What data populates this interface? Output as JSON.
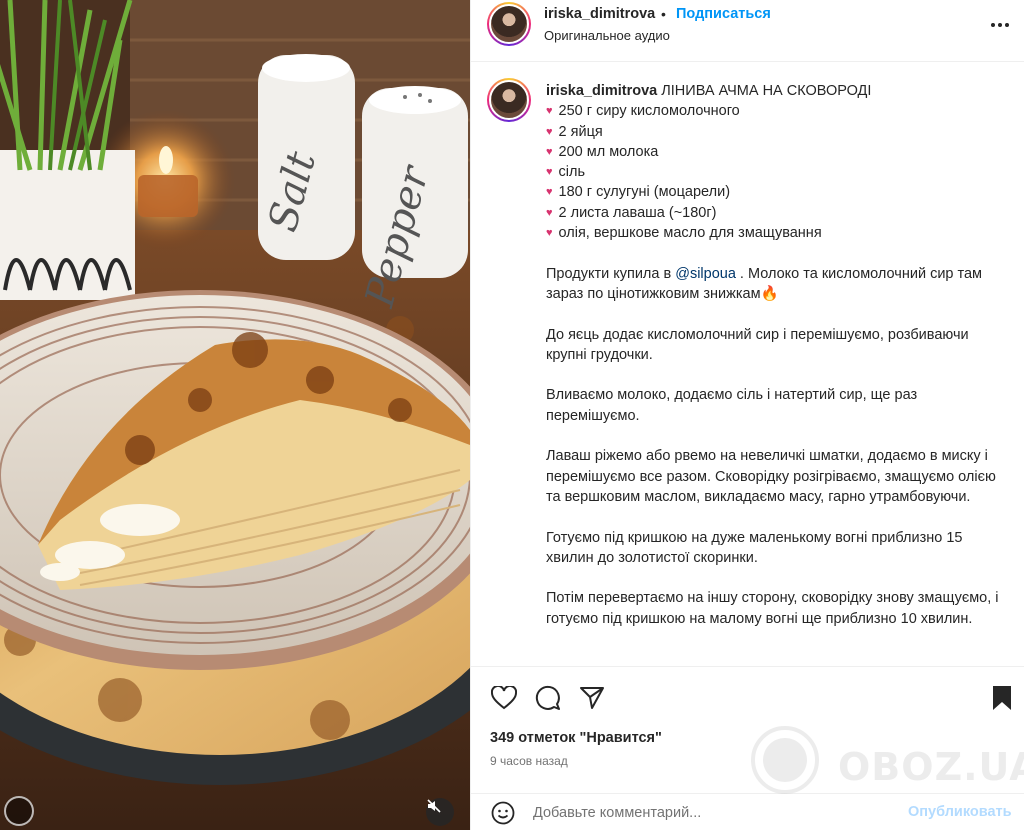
{
  "header": {
    "username": "iriska_dimitrova",
    "separator": "•",
    "follow_label": "Подписаться",
    "audio_label": "Оригинальное аудио",
    "more_icon": "more-horizontal-icon"
  },
  "caption": {
    "username": "iriska_dimitrova",
    "title": "ЛІНИВА АЧМА НА СКОВОРОДІ",
    "ingredients": [
      "250 г сиру кисломолочного",
      "2 яйця",
      "200 мл молока",
      "сіль",
      "180 г сулугуні (моцарели)",
      "2 листа лаваша (~180г)",
      "олія, вершкове масло для змащування"
    ],
    "shop_prefix": "Продукти купила в ",
    "shop_mention": "@silpoua",
    "shop_suffix": " . Молоко та кисломолочний сир там зараз по цінотижковим знижкам🔥",
    "paragraphs": [
      "До яєць додає кисломолочний сир і перемішуємо, розбиваючи крупні грудочки.",
      "Вливаємо молоко, додаємо сіль і натертий сир, ще раз перемішуємо.",
      "Лаваш ріжемо або рвемо на невеличкі шматки, додаємо в миску і перемішуємо все разом. Сковорідку розігріваємо, змащуємо олією та вершковим маслом, викладаємо масу, гарно утрамбовуючи.",
      "Готуємо під кришкою на дуже маленькому вогні приблизно 15 хвилин до золотистої скоринки.",
      "Потім перевертаємо на іншу сторону, сковорідку знову змащуємо, і готуємо під кришкою на малому вогні ще приблизно 10 хвилин."
    ]
  },
  "actions": {
    "likes": "349 отметок \"Нравится\"",
    "time_ago": "9 часов назад"
  },
  "comment": {
    "placeholder": "Добавьте комментарий...",
    "publish_label": "Опубликовать"
  },
  "media": {
    "salt_label": "Salt",
    "pepper_label": "Pepper"
  },
  "watermark": {
    "text": "OBOZ.UA"
  },
  "colors": {
    "link_blue": "#0095f6",
    "publish_disabled": "#b3dbff",
    "mention": "#00376b",
    "heart_bullet": "#d7336f"
  }
}
